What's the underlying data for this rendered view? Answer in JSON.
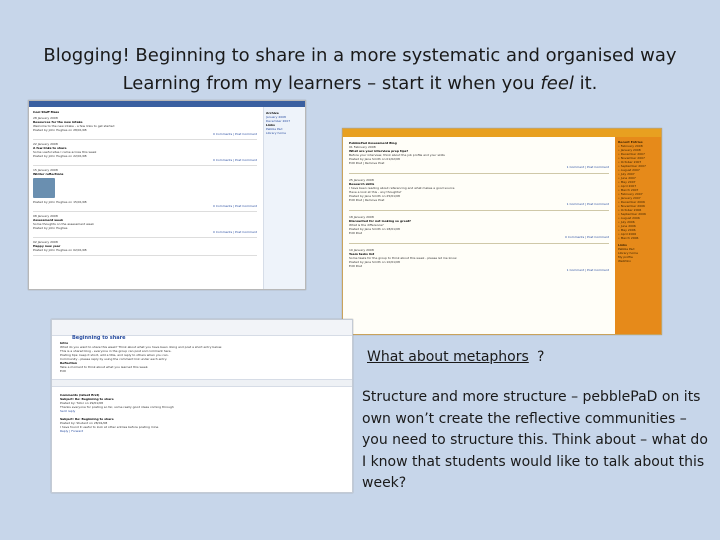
{
  "title": {
    "line1": "Blogging! Beginning to share in a more systematic and organised way",
    "line2_prefix": "Learning from my learners – start it when you ",
    "line2_emph": "feel",
    "line2_suffix": " it."
  },
  "metaphors": {
    "link_text": "What about metaphors",
    "suffix": "?"
  },
  "body_text": "Structure and more structure – pebblePaD on its own won’t create the reflective communities – you need to structure this. Think about – what do I know that students would like to talk about this week?",
  "shot1": {
    "blog_title": "Cool Stuff Mass",
    "posts": [
      {
        "date": "28 January 2008",
        "title": "Resources for the new intake",
        "lines": [
          "Welcome to the new intake - a few links to get started",
          "Posted by John Hughes on 28/01/08"
        ],
        "comment": "0 Comments | Post Comment"
      },
      {
        "date": "22 January 2008",
        "title": "A few links to share",
        "lines": [
          "Some useful sites I came across this week",
          "Posted by John Hughes on 22/01/08"
        ],
        "comment": "0 Comments | Post Comment"
      },
      {
        "date": "15 January 2008",
        "title": "Winter reflections",
        "lines": [
          "Posted by John Hughes on 15/01/08"
        ],
        "comment": "0 Comments | Post Comment",
        "thumb": true
      },
      {
        "date": "08 January 2008",
        "title": "Assessment week",
        "lines": [
          "Some thoughts on the assessment week",
          "Posted by John Hughes"
        ],
        "comment": "0 Comments | Post Comment"
      },
      {
        "date": "02 January 2008",
        "title": "Happy new year",
        "lines": [
          "Posted by John Hughes on 02/01/08"
        ],
        "comment": ""
      }
    ],
    "sidebar": [
      "Archive",
      "January 2008",
      "December 2007",
      "Links",
      "Pebble Pad",
      "Library home"
    ]
  },
  "shot2": {
    "blog_title": "PebblePad Assessment Blog",
    "posts": [
      {
        "date": "01 February 2008",
        "title": "What are your interview prep tips?",
        "lines": [
          "Before your interview, think about the job profile and your skills",
          "Posted by Jane Smith on 01/02/08",
          "Edit Post | Remove Post"
        ],
        "comment": "1 Comment | Post Comment"
      },
      {
        "date": "25 January 2008",
        "title": "Research skills",
        "lines": [
          "I have been reading about referencing and what makes a good source",
          "Have a look at this - any thoughts?",
          "Posted by Jane Smith on 25/01/08",
          "Edit Post | Remove Post"
        ],
        "comment": "1 Comment | Post Comment"
      },
      {
        "date": "18 January 2008",
        "title": "Discounted for not looking so great?",
        "lines": [
          "What is the difference?",
          "Posted by Jane Smith on 18/01/08",
          "Edit Post"
        ],
        "comment": "0 Comments | Post Comment"
      },
      {
        "date": "10 January 2008",
        "title": "Team tasks list",
        "lines": [
          "Some tasks for the group to think about this week - please let me know",
          "Posted by Jane Smith on 10/01/08",
          "Edit Post"
        ],
        "comment": "1 Comment | Post Comment"
      }
    ],
    "sidebar_title": "Recent Entries",
    "sidebar": [
      "February 2008",
      "January 2008",
      "December 2007",
      "November 2007",
      "October 2007",
      "September 2007",
      "August 2007",
      "July 2007",
      "June 2007",
      "May 2007",
      "April 2007",
      "March 2007",
      "February 2007",
      "January 2007",
      "December 2006",
      "November 2006",
      "October 2006",
      "September 2006",
      "August 2006",
      "July 2006",
      "June 2006",
      "May 2006",
      "April 2006",
      "March 2006"
    ],
    "links_title": "Links",
    "links": [
      "Pebble Pad",
      "Library home",
      "My profile",
      "Webfolio"
    ]
  },
  "shot3": {
    "header": "Beginning to share",
    "intro": [
      "Intro",
      "What do you want to share this week? Think about what you have been doing and post a short entry below.",
      "This is a shared blog - everyone in the group can post and comment here.",
      "Posting tips: keep it short, add a title, and reply to others when you can.",
      "Community - please reply by using the comment link under each entry.",
      "Reflection",
      "Take a moment to think about what you learned this week.",
      "Edit"
    ],
    "thread_title": "Comments (latest first)",
    "thread": [
      "Subject: Re: Beginning to share",
      "Posted by: Tutor on 29/01/08",
      "Thanks everyone for posting so far, some really good ideas coming through",
      "Sent reply",
      "Subject: Re: Beginning to share",
      "Posted by: Student on 28/01/08",
      "I have found it useful to look at other entries before posting mine",
      "Reply | Forward"
    ]
  }
}
